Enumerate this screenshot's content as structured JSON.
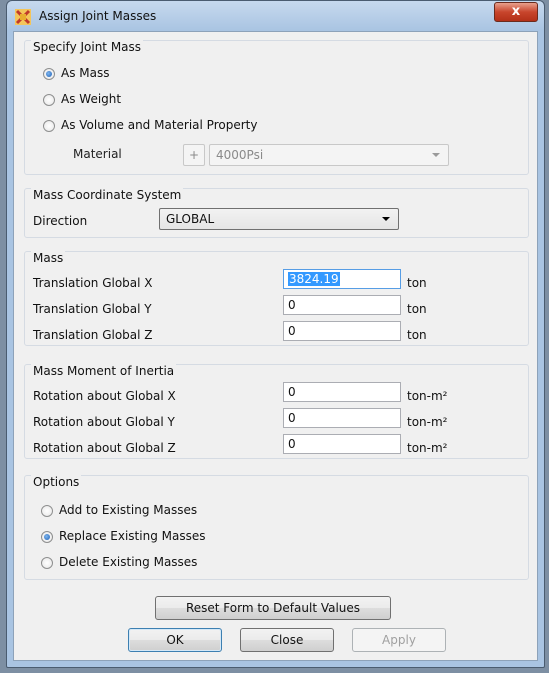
{
  "window": {
    "title": "Assign Joint Masses",
    "close_glyph": "x"
  },
  "specify": {
    "title": "Specify Joint Mass",
    "options": [
      "As Mass",
      "As Weight",
      "As Volume and Material Property"
    ],
    "selected": 0,
    "material_label": "Material",
    "add_button": "+",
    "material_value": "4000Psi"
  },
  "coord": {
    "title": "Mass Coordinate System",
    "direction_label": "Direction",
    "direction_value": "GLOBAL"
  },
  "mass": {
    "title": "Mass",
    "rows": [
      {
        "label": "Translation Global X",
        "value": "3824.19",
        "unit": "ton"
      },
      {
        "label": "Translation Global Y",
        "value": "0",
        "unit": "ton"
      },
      {
        "label": "Translation Global Z",
        "value": "0",
        "unit": "ton"
      }
    ]
  },
  "inertia": {
    "title": "Mass Moment of Inertia",
    "rows": [
      {
        "label": "Rotation about Global X",
        "value": "0",
        "unit": "ton-m²"
      },
      {
        "label": "Rotation about Global Y",
        "value": "0",
        "unit": "ton-m²"
      },
      {
        "label": "Rotation about Global Z",
        "value": "0",
        "unit": "ton-m²"
      }
    ]
  },
  "options": {
    "title": "Options",
    "items": [
      "Add to Existing Masses",
      "Replace Existing Masses",
      "Delete Existing Masses"
    ],
    "selected": 1
  },
  "buttons": {
    "reset": "Reset Form to Default Values",
    "ok": "OK",
    "close": "Close",
    "apply": "Apply"
  },
  "colors": {
    "accent": "#3399ff",
    "title_gradient": "#a9c4e2"
  }
}
